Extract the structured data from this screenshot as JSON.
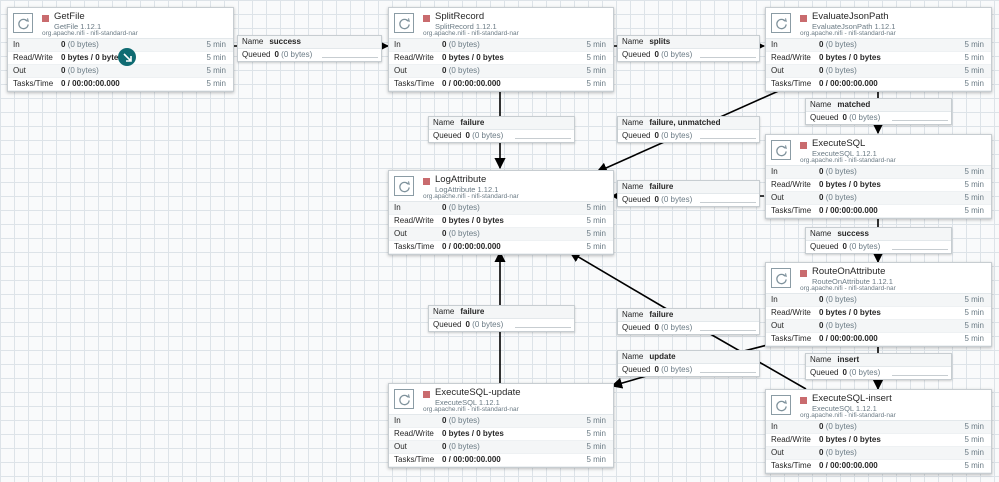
{
  "processors": [
    {
      "id": "getfile",
      "name": "GetFile",
      "version": "GetFile 1.12.1",
      "bundle": "org.apache.nifi - nifi-standard-nar",
      "in": "0",
      "in_bytes": "(0 bytes)",
      "rw": "0 bytes / 0 bytes",
      "out": "0",
      "out_bytes": "(0 bytes)",
      "tasks": "0 / 00:00:00.000",
      "window": "5 min"
    },
    {
      "id": "splitrecord",
      "name": "SplitRecord",
      "version": "SplitRecord 1.12.1",
      "bundle": "org.apache.nifi - nifi-standard-nar",
      "in": "0",
      "in_bytes": "(0 bytes)",
      "rw": "0 bytes / 0 bytes",
      "out": "0",
      "out_bytes": "(0 bytes)",
      "tasks": "0 / 00:00:00.000",
      "window": "5 min"
    },
    {
      "id": "evaluatejsonpath",
      "name": "EvaluateJsonPath",
      "version": "EvaluateJsonPath 1.12.1",
      "bundle": "org.apache.nifi - nifi-standard-nar",
      "in": "0",
      "in_bytes": "(0 bytes)",
      "rw": "0 bytes / 0 bytes",
      "out": "0",
      "out_bytes": "(0 bytes)",
      "tasks": "0 / 00:00:00.000",
      "window": "5 min"
    },
    {
      "id": "logattribute",
      "name": "LogAttribute",
      "version": "LogAttribute 1.12.1",
      "bundle": "org.apache.nifi - nifi-standard-nar",
      "in": "0",
      "in_bytes": "(0 bytes)",
      "rw": "0 bytes / 0 bytes",
      "out": "0",
      "out_bytes": "(0 bytes)",
      "tasks": "0 / 00:00:00.000",
      "window": "5 min"
    },
    {
      "id": "executesql",
      "name": "ExecuteSQL",
      "version": "ExecuteSQL 1.12.1",
      "bundle": "org.apache.nifi - nifi-standard-nar",
      "in": "0",
      "in_bytes": "(0 bytes)",
      "rw": "0 bytes / 0 bytes",
      "out": "0",
      "out_bytes": "(0 bytes)",
      "tasks": "0 / 00:00:00.000",
      "window": "5 min"
    },
    {
      "id": "routeonattribute",
      "name": "RouteOnAttribute",
      "version": "RouteOnAttribute 1.12.1",
      "bundle": "org.apache.nifi - nifi-standard-nar",
      "in": "0",
      "in_bytes": "(0 bytes)",
      "rw": "0 bytes / 0 bytes",
      "out": "0",
      "out_bytes": "(0 bytes)",
      "tasks": "0 / 00:00:00.000",
      "window": "5 min"
    },
    {
      "id": "executesql-update",
      "name": "ExecuteSQL-update",
      "version": "ExecuteSQL 1.12.1",
      "bundle": "org.apache.nifi - nifi-standard-nar",
      "in": "0",
      "in_bytes": "(0 bytes)",
      "rw": "0 bytes / 0 bytes",
      "out": "0",
      "out_bytes": "(0 bytes)",
      "tasks": "0 / 00:00:00.000",
      "window": "5 min"
    },
    {
      "id": "executesql-insert",
      "name": "ExecuteSQL-insert",
      "version": "ExecuteSQL 1.12.1",
      "bundle": "org.apache.nifi - nifi-standard-nar",
      "in": "0",
      "in_bytes": "(0 bytes)",
      "rw": "0 bytes / 0 bytes",
      "out": "0",
      "out_bytes": "(0 bytes)",
      "tasks": "0 / 00:00:00.000",
      "window": "5 min"
    }
  ],
  "connections": [
    {
      "id": "c-success-1",
      "name": "success",
      "queued": "0",
      "queued_bytes": "(0 bytes)"
    },
    {
      "id": "c-splits",
      "name": "splits",
      "queued": "0",
      "queued_bytes": "(0 bytes)"
    },
    {
      "id": "c-failure-split",
      "name": "failure",
      "queued": "0",
      "queued_bytes": "(0 bytes)"
    },
    {
      "id": "c-failure-unmatched",
      "name": "failure, unmatched",
      "queued": "0",
      "queued_bytes": "(0 bytes)"
    },
    {
      "id": "c-matched",
      "name": "matched",
      "queued": "0",
      "queued_bytes": "(0 bytes)"
    },
    {
      "id": "c-failure-exec",
      "name": "failure",
      "queued": "0",
      "queued_bytes": "(0 bytes)"
    },
    {
      "id": "c-success-2",
      "name": "success",
      "queued": "0",
      "queued_bytes": "(0 bytes)"
    },
    {
      "id": "c-failure-update",
      "name": "failure",
      "queued": "0",
      "queued_bytes": "(0 bytes)"
    },
    {
      "id": "c-failure-insert",
      "name": "failure",
      "queued": "0",
      "queued_bytes": "(0 bytes)"
    },
    {
      "id": "c-update",
      "name": "update",
      "queued": "0",
      "queued_bytes": "(0 bytes)"
    },
    {
      "id": "c-insert",
      "name": "insert",
      "queued": "0",
      "queued_bytes": "(0 bytes)"
    }
  ],
  "labels": {
    "in": "In",
    "read_write": "Read/Write",
    "out": "Out",
    "tasks_time": "Tasks/Time",
    "conn_name": "Name",
    "conn_queued": "Queued"
  },
  "colors": {
    "stopped": "#c96b6e",
    "edge": "#000000",
    "canvas": "#f9fafb",
    "badge": "#0f6b72"
  },
  "icons": {
    "processor": "processor-refresh-icon",
    "stopped": "stopped-square-icon",
    "badge": "move-arrow-icon"
  }
}
